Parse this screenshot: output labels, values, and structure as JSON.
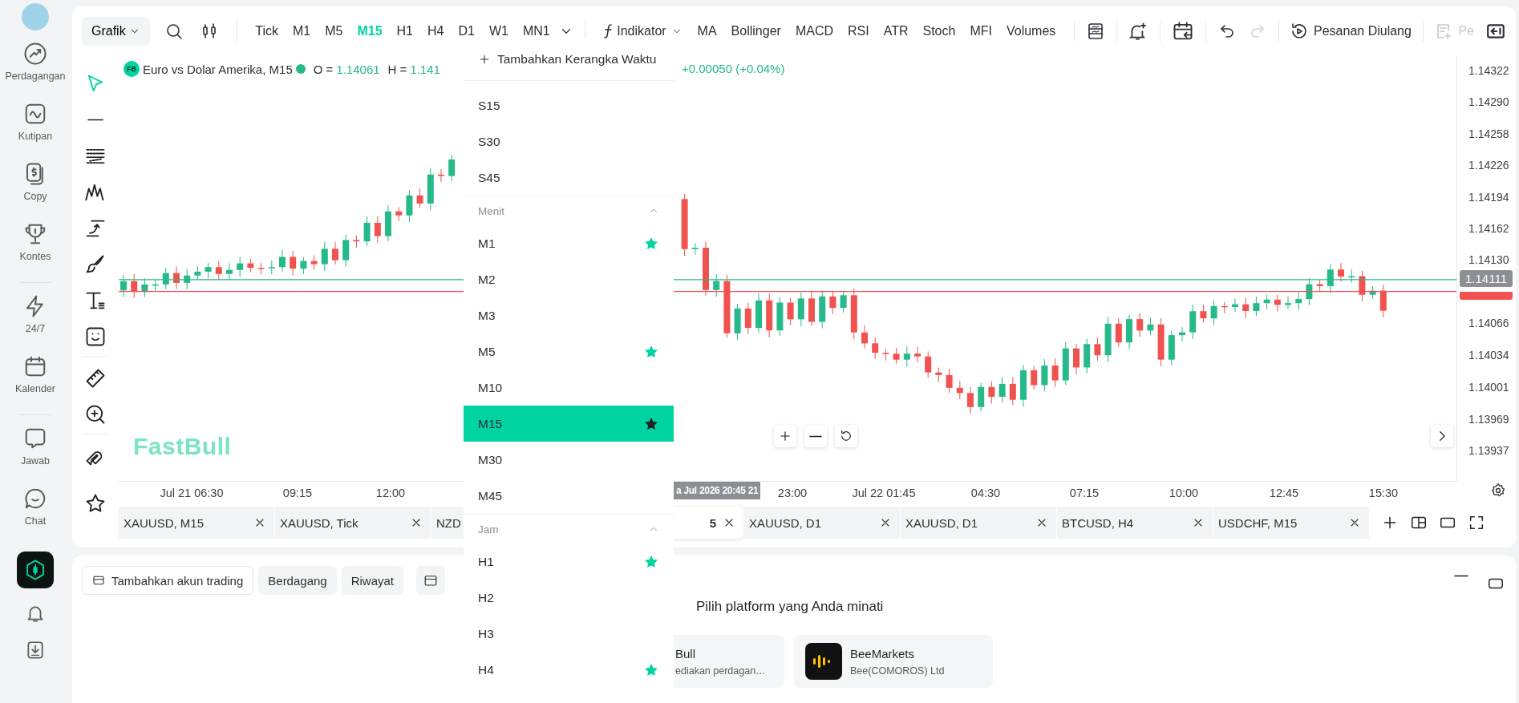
{
  "sidebar": {
    "items": [
      {
        "kind": "trade",
        "label": "Perdagangan"
      },
      {
        "kind": "quotes",
        "label": "Kutipan"
      },
      {
        "kind": "copy",
        "label": "Copy"
      },
      {
        "kind": "contest",
        "label": "Kontes"
      },
      {
        "kind": "divider"
      },
      {
        "kind": "flash",
        "label": "24/7"
      },
      {
        "kind": "calendar",
        "label": "Kalender"
      },
      {
        "kind": "divider"
      },
      {
        "kind": "ask",
        "label": "Jawab"
      },
      {
        "kind": "chat",
        "label": "Chat"
      }
    ]
  },
  "toolbar": {
    "chart_type": "Grafik",
    "timeframes": [
      {
        "label": "Tick",
        "selected": false
      },
      {
        "label": "M1",
        "selected": false
      },
      {
        "label": "M5",
        "selected": false
      },
      {
        "label": "M15",
        "selected": true
      },
      {
        "label": "H1",
        "selected": false
      },
      {
        "label": "H4",
        "selected": false
      },
      {
        "label": "D1",
        "selected": false
      },
      {
        "label": "W1",
        "selected": false
      },
      {
        "label": "MN1",
        "selected": false
      }
    ],
    "indicator_menu": "Indikator",
    "indicators": [
      "MA",
      "Bollinger",
      "MACD",
      "RSI",
      "ATR",
      "Stoch",
      "MFI",
      "Volumes"
    ],
    "repeat_order": "Pesanan Diulang",
    "pending_action": {
      "label": "Pe",
      "disabled": true
    }
  },
  "drawing_tools": [
    {
      "kind": "cursor",
      "selected": true
    },
    {
      "kind": "line",
      "selected": false
    },
    {
      "kind": "fib",
      "selected": false
    },
    {
      "kind": "pattern",
      "selected": false
    },
    {
      "kind": "trend",
      "selected": false
    },
    {
      "kind": "brush",
      "selected": false
    },
    {
      "kind": "text",
      "selected": false
    },
    {
      "kind": "emoji",
      "selected": false
    },
    {
      "kind": "divider"
    },
    {
      "kind": "ruler",
      "selected": false
    },
    {
      "kind": "zoom",
      "selected": false
    },
    {
      "kind": "divider"
    },
    {
      "kind": "magnet",
      "selected": false
    },
    {
      "kind": "star",
      "selected": false
    }
  ],
  "chart": {
    "symbol_badge": "FB",
    "title": "Euro vs Dolar Amerika, M15",
    "live": true,
    "open_label": "O =",
    "open_value": "1.14061",
    "high_label": "H =",
    "high_value": "1.141",
    "change": "+0.00050 (+0.04%)",
    "logo": "FastBull",
    "price_axis": [
      "1.14322",
      "1.14290",
      "1.14258",
      "1.14226",
      "1.14194",
      "1.14162",
      "1.14130",
      "1.14066",
      "1.14034",
      "1.14001",
      "1.13969",
      "1.13937"
    ],
    "current_price": "1.14111",
    "time_axis": [
      "Jul 21 06:30",
      "09:15",
      "12:00",
      "23:00",
      "Jul 22 01:45",
      "04:30",
      "07:15",
      "10:00",
      "12:45",
      "15:30"
    ],
    "crosshair_time": "a Jul 2026 20:45 21"
  },
  "symbol_tabs": [
    {
      "label": "XAUUSD, M15",
      "selected": false,
      "clipped": false
    },
    {
      "label": "XAUUSD, Tick",
      "selected": false,
      "clipped": false
    },
    {
      "label": "NZD",
      "selected": false,
      "clipped": false
    },
    {
      "label": "5",
      "selected": true,
      "clipped": true
    },
    {
      "label": "XAUUSD, D1",
      "selected": false,
      "clipped": false
    },
    {
      "label": "XAUUSD, D1",
      "selected": false,
      "clipped": false
    },
    {
      "label": "BTCUSD, H4",
      "selected": false,
      "clipped": false
    },
    {
      "label": "USDCHF, M15",
      "selected": false,
      "clipped": false
    }
  ],
  "account_panel": {
    "buttons": [
      {
        "kind": "add-account",
        "label": "Tambahkan akun trading"
      },
      {
        "kind": "plain",
        "label": "Berdagang"
      },
      {
        "kind": "plain",
        "label": "Riwayat"
      }
    ],
    "heading": "Pilih platform yang Anda minati",
    "platforms": [
      {
        "name": "Bull",
        "subtitle": "ediakan perdagan…",
        "logo_visible": false
      },
      {
        "name": "BeeMarkets",
        "subtitle": "Bee(COMOROS) Ltd",
        "logo_visible": true
      }
    ]
  },
  "timeframe_menu": {
    "add_label": "Tambahkan Kerangka Waktu",
    "groups": [
      {
        "items": [
          {
            "label": "S15",
            "starred": false,
            "selected": false
          },
          {
            "label": "S30",
            "starred": false,
            "selected": false
          },
          {
            "label": "S45",
            "starred": false,
            "selected": false
          }
        ]
      },
      {
        "title": "Menit",
        "items": [
          {
            "label": "M1",
            "starred": true,
            "selected": false
          },
          {
            "label": "M2",
            "starred": false,
            "selected": false
          },
          {
            "label": "M3",
            "starred": false,
            "selected": false
          },
          {
            "label": "M5",
            "starred": true,
            "selected": false
          },
          {
            "label": "M10",
            "starred": false,
            "selected": false
          },
          {
            "label": "M15",
            "starred": true,
            "selected": true
          },
          {
            "label": "M30",
            "starred": false,
            "selected": false
          },
          {
            "label": "M45",
            "starred": false,
            "selected": false
          }
        ]
      },
      {
        "title": "Jam",
        "items": [
          {
            "label": "H1",
            "starred": true,
            "selected": false
          },
          {
            "label": "H2",
            "starred": false,
            "selected": false
          },
          {
            "label": "H3",
            "starred": false,
            "selected": false
          },
          {
            "label": "H4",
            "starred": true,
            "selected": false
          }
        ]
      }
    ]
  }
}
